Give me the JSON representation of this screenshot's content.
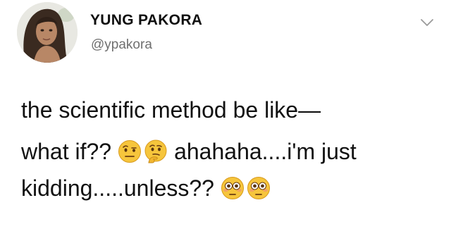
{
  "profile": {
    "display_name": "YUNG PAKORA",
    "handle": "@ypakora",
    "avatar_icon": "profile-photo",
    "menu_icon": "chevron-down-icon"
  },
  "tweet": {
    "line1": "the scientific method be like—",
    "line2_a": "what if??",
    "line2_b": "ahahaha....i'm just",
    "line3_a": "kidding.....unless??",
    "emojis_line2": [
      "face-with-raised-eyebrow",
      "thinking-face"
    ],
    "emojis_line3": [
      "flushed-face",
      "flushed-face"
    ]
  }
}
